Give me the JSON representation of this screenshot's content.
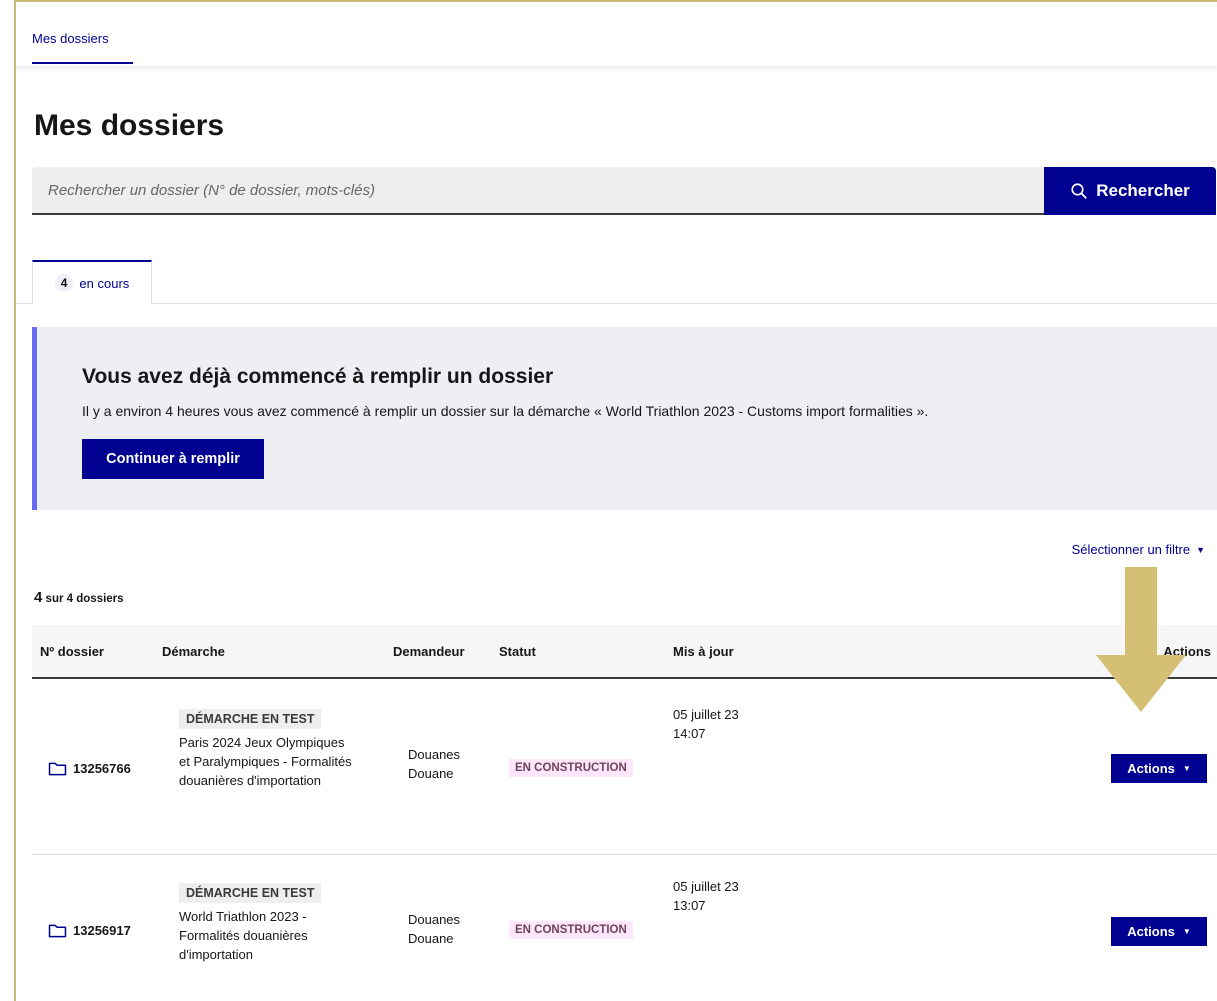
{
  "nav": {
    "active_tab": "Mes dossiers"
  },
  "page": {
    "title": "Mes dossiers"
  },
  "search": {
    "placeholder": "Rechercher un dossier (N° de dossier, mots-clés)",
    "button_label": "Rechercher"
  },
  "tabs": [
    {
      "count": "4",
      "label": "en cours"
    }
  ],
  "callout": {
    "title": "Vous avez déjà commencé à remplir un dossier",
    "text": "Il y a environ 4 heures vous avez commencé à remplir un dossier sur la démarche « World Triathlon 2023 - Customs import formalities ».",
    "button_label": "Continuer à remplir"
  },
  "filter": {
    "label": "Sélectionner un filtre"
  },
  "summary": {
    "count": "4",
    "text": "sur 4 dossiers"
  },
  "table": {
    "headers": {
      "number": "Nº dossier",
      "procedure": "Démarche",
      "applicant": "Demandeur",
      "status": "Statut",
      "updated": "Mis à jour",
      "actions": "Actions"
    },
    "rows": [
      {
        "number": "13256766",
        "procedure_badge": "DÉMARCHE EN TEST",
        "procedure_name": "Paris 2024 Jeux Olympiques et Paralympiques - Formalités douanières d'importation",
        "applicant_line1": "Douanes",
        "applicant_line2": "Douane",
        "status": "EN CONSTRUCTION",
        "updated_date": "05 juillet 23",
        "updated_time": "14:07",
        "actions_label": "Actions"
      },
      {
        "number": "13256917",
        "procedure_badge": "DÉMARCHE EN TEST",
        "procedure_name": "World Triathlon 2023 - Formalités douanières d'importation",
        "applicant_line1": "Douanes",
        "applicant_line2": "Douane",
        "status": "EN CONSTRUCTION",
        "updated_date": "05 juillet 23",
        "updated_time": "13:07",
        "actions_label": "Actions"
      }
    ]
  },
  "colors": {
    "primary": "#000091",
    "callout_bg": "#eeeef5",
    "callout_border": "#6a6af4",
    "status_bg": "#fee7fc",
    "annotation_arrow": "#d4bf74"
  },
  "icons": {
    "search": "search-icon",
    "folder": "folder-icon",
    "caret": "caret-down-icon",
    "annotation": "arrow-down-icon"
  }
}
